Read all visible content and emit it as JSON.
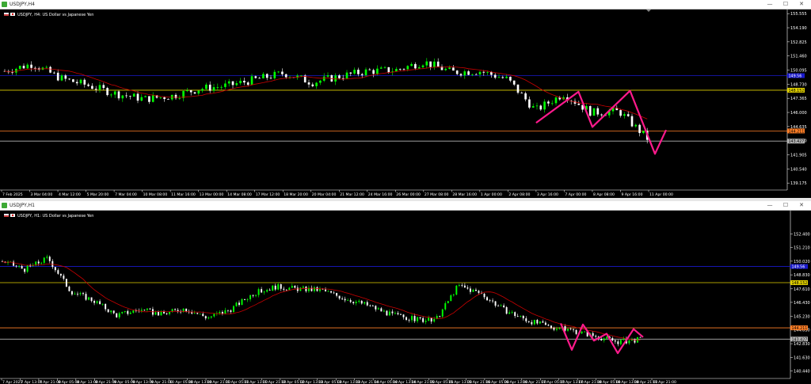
{
  "windows": [
    {
      "title": "USDJPY,H4",
      "header": "USDJPY, H4:  US Dollar vs Japanese Yen",
      "buttons": {
        "minimize": "—",
        "maximize": "☐",
        "close": "✕"
      }
    },
    {
      "title": "USDJPY,H1",
      "header": "USDJPY, H1:  US Dollar vs Japanese Yen",
      "buttons": {
        "minimize": "—",
        "maximize": "☐",
        "close": "✕"
      }
    }
  ],
  "colors": {
    "background": "#000000",
    "bull_candle": "#00ff00",
    "bear_candle": "#ffffff",
    "moving_average": "#c80000",
    "pattern_line": "#ff1a8c",
    "blue_level": "#1a1acc",
    "yellow_level": "#e0d000",
    "orange_level": "#ff7f27",
    "gray_level": "#b4b4b4"
  },
  "chart_data": [
    {
      "type": "candlestick",
      "symbol": "USDJPY",
      "timeframe": "H4",
      "ylim": [
        138.5,
        155.8
      ],
      "y_ticks": [
        "155.555",
        "154.190",
        "152.825",
        "151.460",
        "150.095",
        "148.730",
        "147.365",
        "146.000",
        "144.635",
        "143.270",
        "141.905",
        "140.540",
        "139.175"
      ],
      "x_ticks": [
        "7 Feb 2025",
        "3 Mar 04:00",
        "4 Mar 12:00",
        "5 Mar 20:00",
        "7 Mar 04:00",
        "10 Mar 08:00",
        "11 Mar 16:00",
        "13 Mar 00:00",
        "14 Mar 08:00",
        "17 Mar 12:00",
        "18 Mar 20:00",
        "20 Mar 04:00",
        "21 Mar 12:00",
        "24 Mar 16:00",
        "26 Mar 00:00",
        "27 Mar 08:00",
        "28 Mar 16:00",
        "1 Apr 00:00",
        "2 Apr 08:00",
        "3 Apr 16:00",
        "7 Apr 00:00",
        "8 Apr 08:00",
        "9 Apr 16:00",
        "11 Apr 00:00"
      ],
      "levels": [
        {
          "name": "blue",
          "value": 149.56,
          "label": "149.56"
        },
        {
          "name": "yellow",
          "value": 148.15,
          "label": "148.152"
        },
        {
          "name": "orange",
          "value": 144.21,
          "label": "144.211"
        },
        {
          "name": "gray",
          "value": 143.23,
          "label": "143.427"
        }
      ],
      "close_points": [
        [
          "7 Feb 2025",
          150.0
        ],
        [
          "3 Mar 04:00",
          150.7
        ],
        [
          "4 Mar 12:00",
          149.3
        ],
        [
          "5 Mar 20:00",
          148.6
        ],
        [
          "7 Mar 04:00",
          147.8
        ],
        [
          "10 Mar 08:00",
          147.3
        ],
        [
          "11 Mar 16:00",
          147.6
        ],
        [
          "13 Mar 00:00",
          148.3
        ],
        [
          "14 Mar 08:00",
          148.6
        ],
        [
          "17 Mar 12:00",
          149.2
        ],
        [
          "18 Mar 20:00",
          149.8
        ],
        [
          "20 Mar 04:00",
          148.9
        ],
        [
          "21 Mar 12:00",
          149.5
        ],
        [
          "24 Mar 16:00",
          150.0
        ],
        [
          "26 Mar 00:00",
          150.1
        ],
        [
          "27 Mar 08:00",
          150.9
        ],
        [
          "28 Mar 16:00",
          149.9
        ],
        [
          "1 Apr 00:00",
          150.0
        ],
        [
          "2 Apr 08:00",
          149.2
        ],
        [
          "3 Apr 16:00",
          146.2
        ],
        [
          "7 Apr 00:00",
          147.8
        ],
        [
          "8 Apr 08:00",
          146.0
        ],
        [
          "9 Apr 16:00",
          146.1
        ],
        [
          "11 Apr 00:00",
          143.5
        ]
      ],
      "pattern_line": [
        [
          "3 Apr 16:00",
          145.0
        ],
        [
          "7 Apr 00:00",
          148.0
        ],
        [
          "8 Apr 08:00",
          144.6
        ],
        [
          "9 Apr 16:00",
          148.1
        ],
        [
          "11 Apr 00:00",
          142.0
        ],
        [
          "11 Apr 00:00",
          144.3
        ]
      ]
    },
    {
      "type": "candlestick",
      "symbol": "USDJPY",
      "timeframe": "H1",
      "ylim": [
        139.8,
        153.6
      ],
      "y_ticks": [
        "152.400",
        "151.210",
        "150.020",
        "148.830",
        "147.610",
        "146.430",
        "145.230",
        "144.030",
        "142.830",
        "141.630",
        "140.440"
      ],
      "x_ticks": [
        "7 Apr 2025",
        "7 Apr 13:00",
        "7 Apr 21:00",
        "8 Apr 05:00",
        "8 Apr 13:00",
        "8 Apr 21:00",
        "9 Apr 05:00",
        "9 Apr 13:00",
        "9 Apr 21:00",
        "10 Apr 05:00",
        "10 Apr 13:00",
        "10 Apr 21:00",
        "11 Apr 05:00",
        "11 Apr 13:00",
        "11 Apr 21:00",
        "12 Apr 05:00",
        "12 Apr 13:00",
        "13 Apr 05:00",
        "13 Apr 13:00",
        "13 Apr 21:00",
        "14 Apr 05:00",
        "14 Apr 13:00",
        "14 Apr 21:00",
        "15 Apr 05:00",
        "15 Apr 13:00",
        "15 Apr 21:00",
        "16 Apr 05:00",
        "16 Apr 13:00",
        "16 Apr 21:00",
        "17 Apr 05:00",
        "17 Apr 13:00",
        "17 Apr 21:00",
        "18 Apr 05:00",
        "18 Apr 13:00",
        "18 Apr 21:00",
        "11 Apr 21:00"
      ],
      "levels": [
        {
          "name": "blue",
          "value": 149.56,
          "label": "149.56"
        },
        {
          "name": "yellow",
          "value": 148.15,
          "label": "148.152"
        },
        {
          "name": "orange",
          "value": 144.21,
          "label": "144.211"
        },
        {
          "name": "gray",
          "value": 143.23,
          "label": "143.427"
        }
      ]
    }
  ]
}
